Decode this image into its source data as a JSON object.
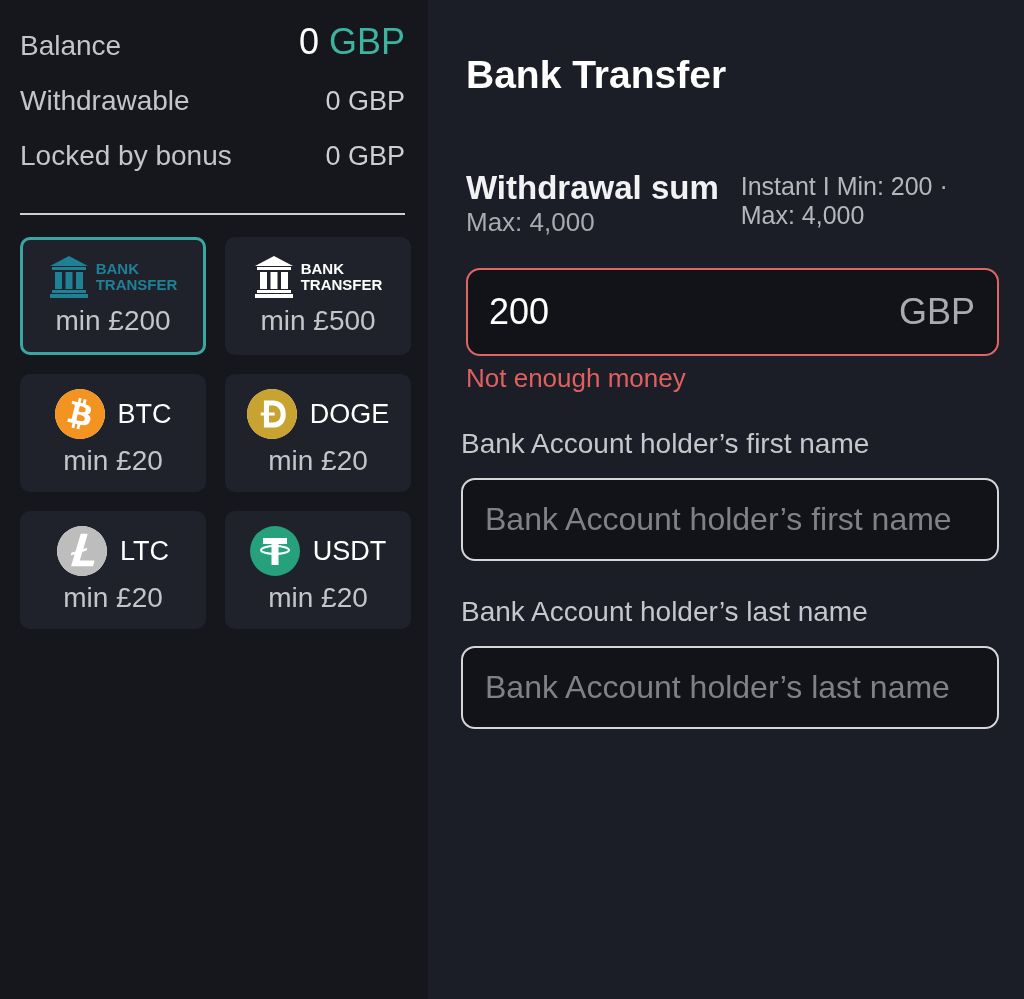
{
  "balances": [
    {
      "kind": "total",
      "label": "Balance",
      "amount": "0",
      "currency": "GBP"
    },
    {
      "kind": "plain",
      "label": "Withdrawable",
      "value": "0 GBP"
    },
    {
      "kind": "plain",
      "label": "Locked by bonus",
      "value": "0 GBP"
    }
  ],
  "methods": [
    {
      "kind": "bank",
      "logo_text": "BANK TRANSFER",
      "min": "min £200",
      "selected": true
    },
    {
      "kind": "bank",
      "logo_text": "BANK TRANSFER",
      "min": "min £500",
      "selected": false
    },
    {
      "kind": "bitcoin",
      "label": "BTC",
      "min": "min £20",
      "selected": false
    },
    {
      "kind": "dogecoin",
      "label": "DOGE",
      "min": "min £20",
      "selected": false
    },
    {
      "kind": "litecoin",
      "label": "LTC",
      "min": "min £20",
      "selected": false
    },
    {
      "kind": "tether",
      "label": "USDT",
      "min": "min £20",
      "selected": false
    }
  ],
  "form": {
    "title": "Bank Transfer",
    "sum": {
      "title": "Withdrawal sum",
      "max": "Max: 4,000",
      "limits": "Instant I Min: 200 · Max: 4,000"
    },
    "amount": {
      "value": "200",
      "currency": "GBP",
      "invalid": true,
      "error": "Not enough money"
    },
    "fields": [
      {
        "label": "Bank Account holder’s first name",
        "placeholder": "Bank Account holder’s first name"
      },
      {
        "label": "Bank Account holder’s last name",
        "placeholder": "Bank Account holder’s last name"
      }
    ]
  }
}
